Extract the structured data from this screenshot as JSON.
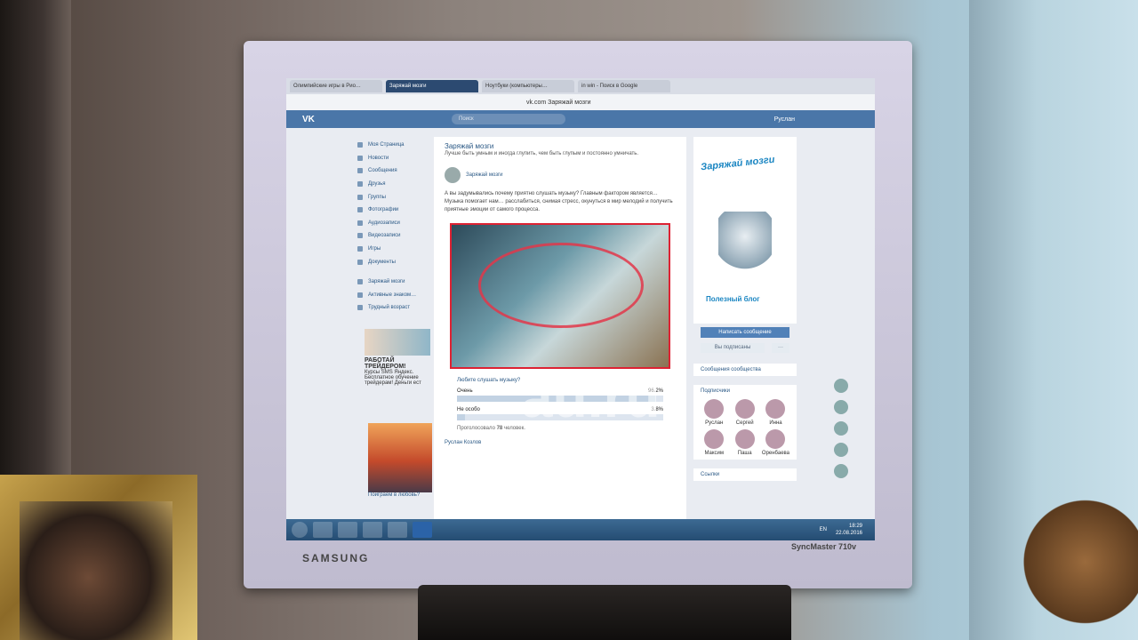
{
  "browser": {
    "tabs": [
      "Олимпийские игры в Рио…",
      "Заряжай мозги",
      "Ноутбуки (компьютеры…",
      "in win - Поиск в Google"
    ],
    "url": "vk.com   Заряжай мозги"
  },
  "vk": {
    "logo": "VK",
    "search_placeholder": "Поиск",
    "user_name": "Руслан",
    "nav": [
      "Моя Страница",
      "Новости",
      "Сообщения",
      "Друзья",
      "Группы",
      "Фотографии",
      "Аудиозаписи",
      "Видеозаписи",
      "Игры",
      "Документы",
      "Заряжай мозги",
      "Активные знаком…",
      "Трудный возраст"
    ],
    "ad1_title": "РАБОТАЙ ТРЕЙДЕРОМ!",
    "ad1_text": "Курсы SMS Яндекс. Бесплатное обучение трейдерам! Деньги ест",
    "ad2_text": "Поиграем в любовь?",
    "group_title": "Заряжай мозги",
    "group_desc": "Лучше быть умным и иногда глупить, чем быть глупым и постоянно умничать.",
    "post_author": "Заряжай мозги",
    "post_text": "А вы задумывались почему приятно слушать музыку? Главным фактором является… Музыка помогает нам… расслабиться, снимая стресс, окунуться в мир мелодий и получить приятные эмоции от самого процесса.",
    "poll_question": "Любите слушать музыку?",
    "poll_options": [
      {
        "label": "Очень",
        "percent": "96.2%",
        "fraction": 0.962
      },
      {
        "label": "Не особо",
        "percent": "3.8%",
        "fraction": 0.038
      }
    ],
    "poll_votes_prefix": "Проголосовало ",
    "poll_votes": "78",
    "poll_votes_suffix": " человек.",
    "post_footer": "Руслан Козлов",
    "cover_top": "Заряжай мозги",
    "cover_bottom": "Полезный блог",
    "write_message": "Написать сообщение",
    "subscribed": "Вы подписаны",
    "more": "···",
    "community_messages": "Сообщения сообщества",
    "subscribers_label": "Подписчики",
    "subscribers": [
      "Руслан",
      "Сергей",
      "Инна",
      "Максим",
      "Паша",
      "Оренбаева"
    ],
    "links_label": "Ссылки"
  },
  "taskbar": {
    "lang": "EN",
    "time": "18:29",
    "date": "22.08.2016"
  },
  "monitor": {
    "brand": "SAMSUNG",
    "model": "SyncMaster 710v"
  },
  "watermark": {
    "main": "au.ru",
    "sub": "интернет-аук"
  }
}
